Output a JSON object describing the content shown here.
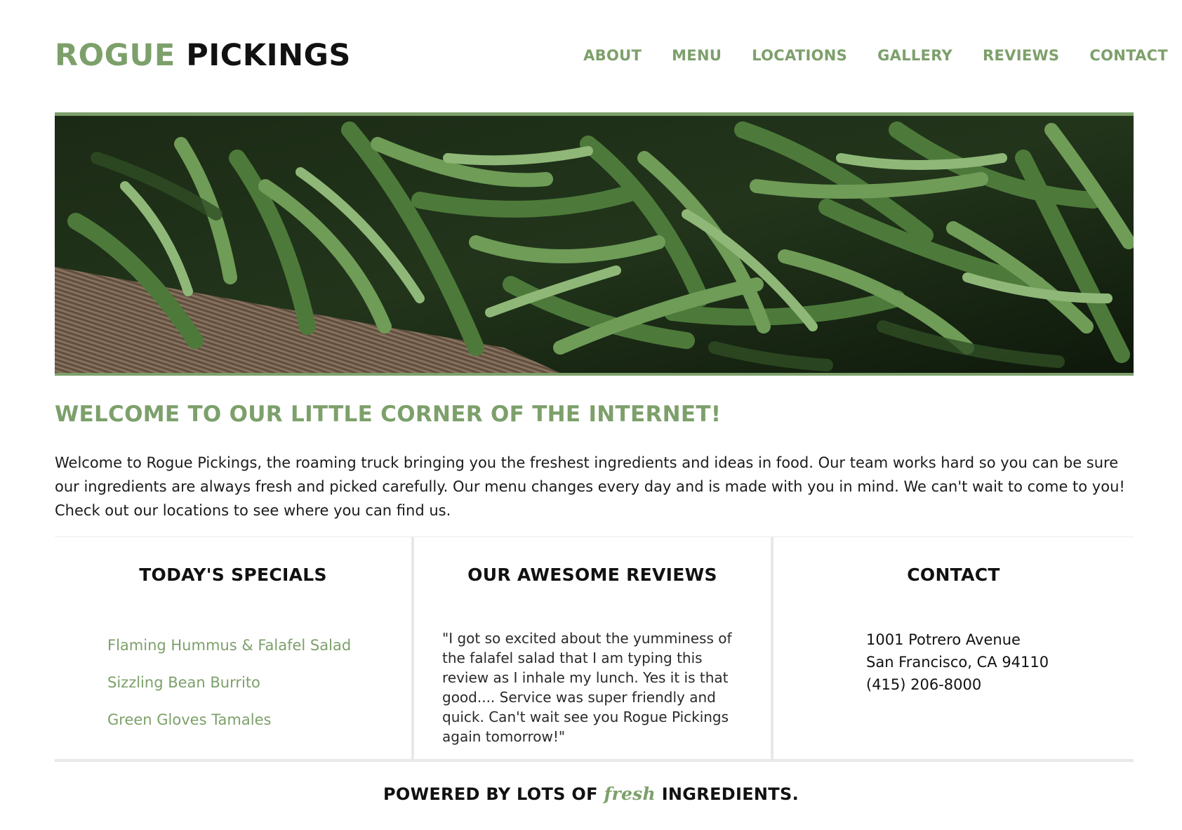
{
  "header": {
    "logo_first": "ROGUE",
    "logo_second": "PICKINGS",
    "nav": [
      {
        "label": "ABOUT"
      },
      {
        "label": "MENU"
      },
      {
        "label": "LOCATIONS"
      },
      {
        "label": "GALLERY"
      },
      {
        "label": "REVIEWS"
      },
      {
        "label": "CONTACT"
      }
    ]
  },
  "welcome": {
    "title": "WELCOME TO OUR LITTLE CORNER OF THE INTERNET!",
    "text": "Welcome to Rogue Pickings, the roaming truck bringing you the freshest ingredients and ideas in food. Our team works hard so you can be sure our ingredients are always fresh and picked carefully. Our menu changes every day and is made with you in mind. We can't wait to come to you! Check out our locations to see where you can find us."
  },
  "specials": {
    "heading": "TODAY'S SPECIALS",
    "items": [
      {
        "label": "Flaming Hummus & Falafel Salad"
      },
      {
        "label": "Sizzling Bean Burrito"
      },
      {
        "label": "Green Gloves Tamales"
      }
    ]
  },
  "reviews": {
    "heading": "OUR AWESOME REVIEWS",
    "text": "\"I got so excited about the yumminess of the falafel salad that I am typing this review as I inhale my lunch. Yes it is that good.... Service was super friendly and quick. Can't wait see you Rogue Pickings again tomorrow!\""
  },
  "contact": {
    "heading": "CONTACT",
    "address_line1": "1001 Potrero Avenue",
    "address_line2": "San Francisco, CA 94110",
    "phone": "(415) 206-8000"
  },
  "footer": {
    "prefix": "POWERED BY LOTS OF",
    "emphasis": "fresh",
    "suffix": "INGREDIENTS."
  },
  "colors": {
    "accent": "#7da06b",
    "text": "#1b1b1b",
    "divider": "#e8e8e8"
  },
  "hero": {
    "icon": "green-beans-photo"
  }
}
